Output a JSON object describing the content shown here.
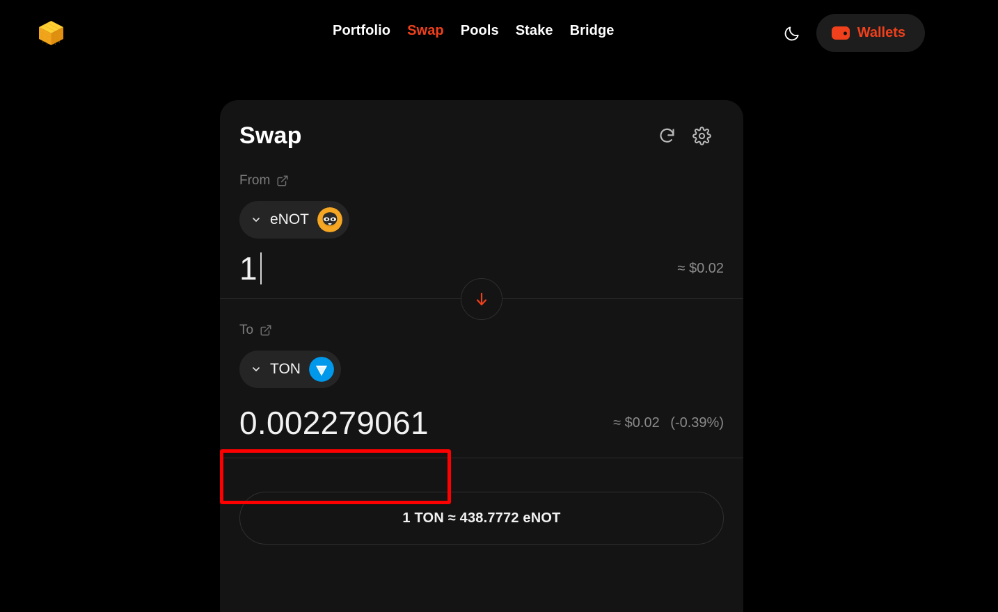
{
  "header": {
    "logo_icon": "gold-cube-logo",
    "nav": [
      {
        "label": "Portfolio",
        "active": false
      },
      {
        "label": "Swap",
        "active": true
      },
      {
        "label": "Pools",
        "active": false
      },
      {
        "label": "Stake",
        "active": false
      },
      {
        "label": "Bridge",
        "active": false
      }
    ],
    "theme_toggle_icon": "moon-icon",
    "wallets": {
      "label": "Wallets",
      "icon": "wallet-icon",
      "accent_color": "#f0401c"
    }
  },
  "swap_card": {
    "title": "Swap",
    "refresh_icon": "refresh-icon",
    "settings_icon": "gear-icon",
    "from": {
      "label": "From",
      "link_icon": "external-link-icon",
      "token": {
        "symbol": "eNOT",
        "logo": "notcoin-raccoon-icon"
      },
      "amount": "1",
      "usd": "≈ $0.02"
    },
    "switch_icon": "arrow-down-icon",
    "to": {
      "label": "To",
      "link_icon": "external-link-icon",
      "token": {
        "symbol": "TON",
        "logo": "ton-diamond-icon"
      },
      "amount": "0.002279061",
      "usd": "≈ $0.02",
      "percent": "(-0.39%)"
    },
    "rate_label": "1 TON ≈ 438.7772 eNOT"
  },
  "annotation": {
    "highlight_color": "#ff0000",
    "target": "to-amount-value"
  },
  "colors": {
    "background": "#000000",
    "card": "#141414",
    "accent": "#f0401c",
    "muted_text": "#8a8a8a"
  }
}
